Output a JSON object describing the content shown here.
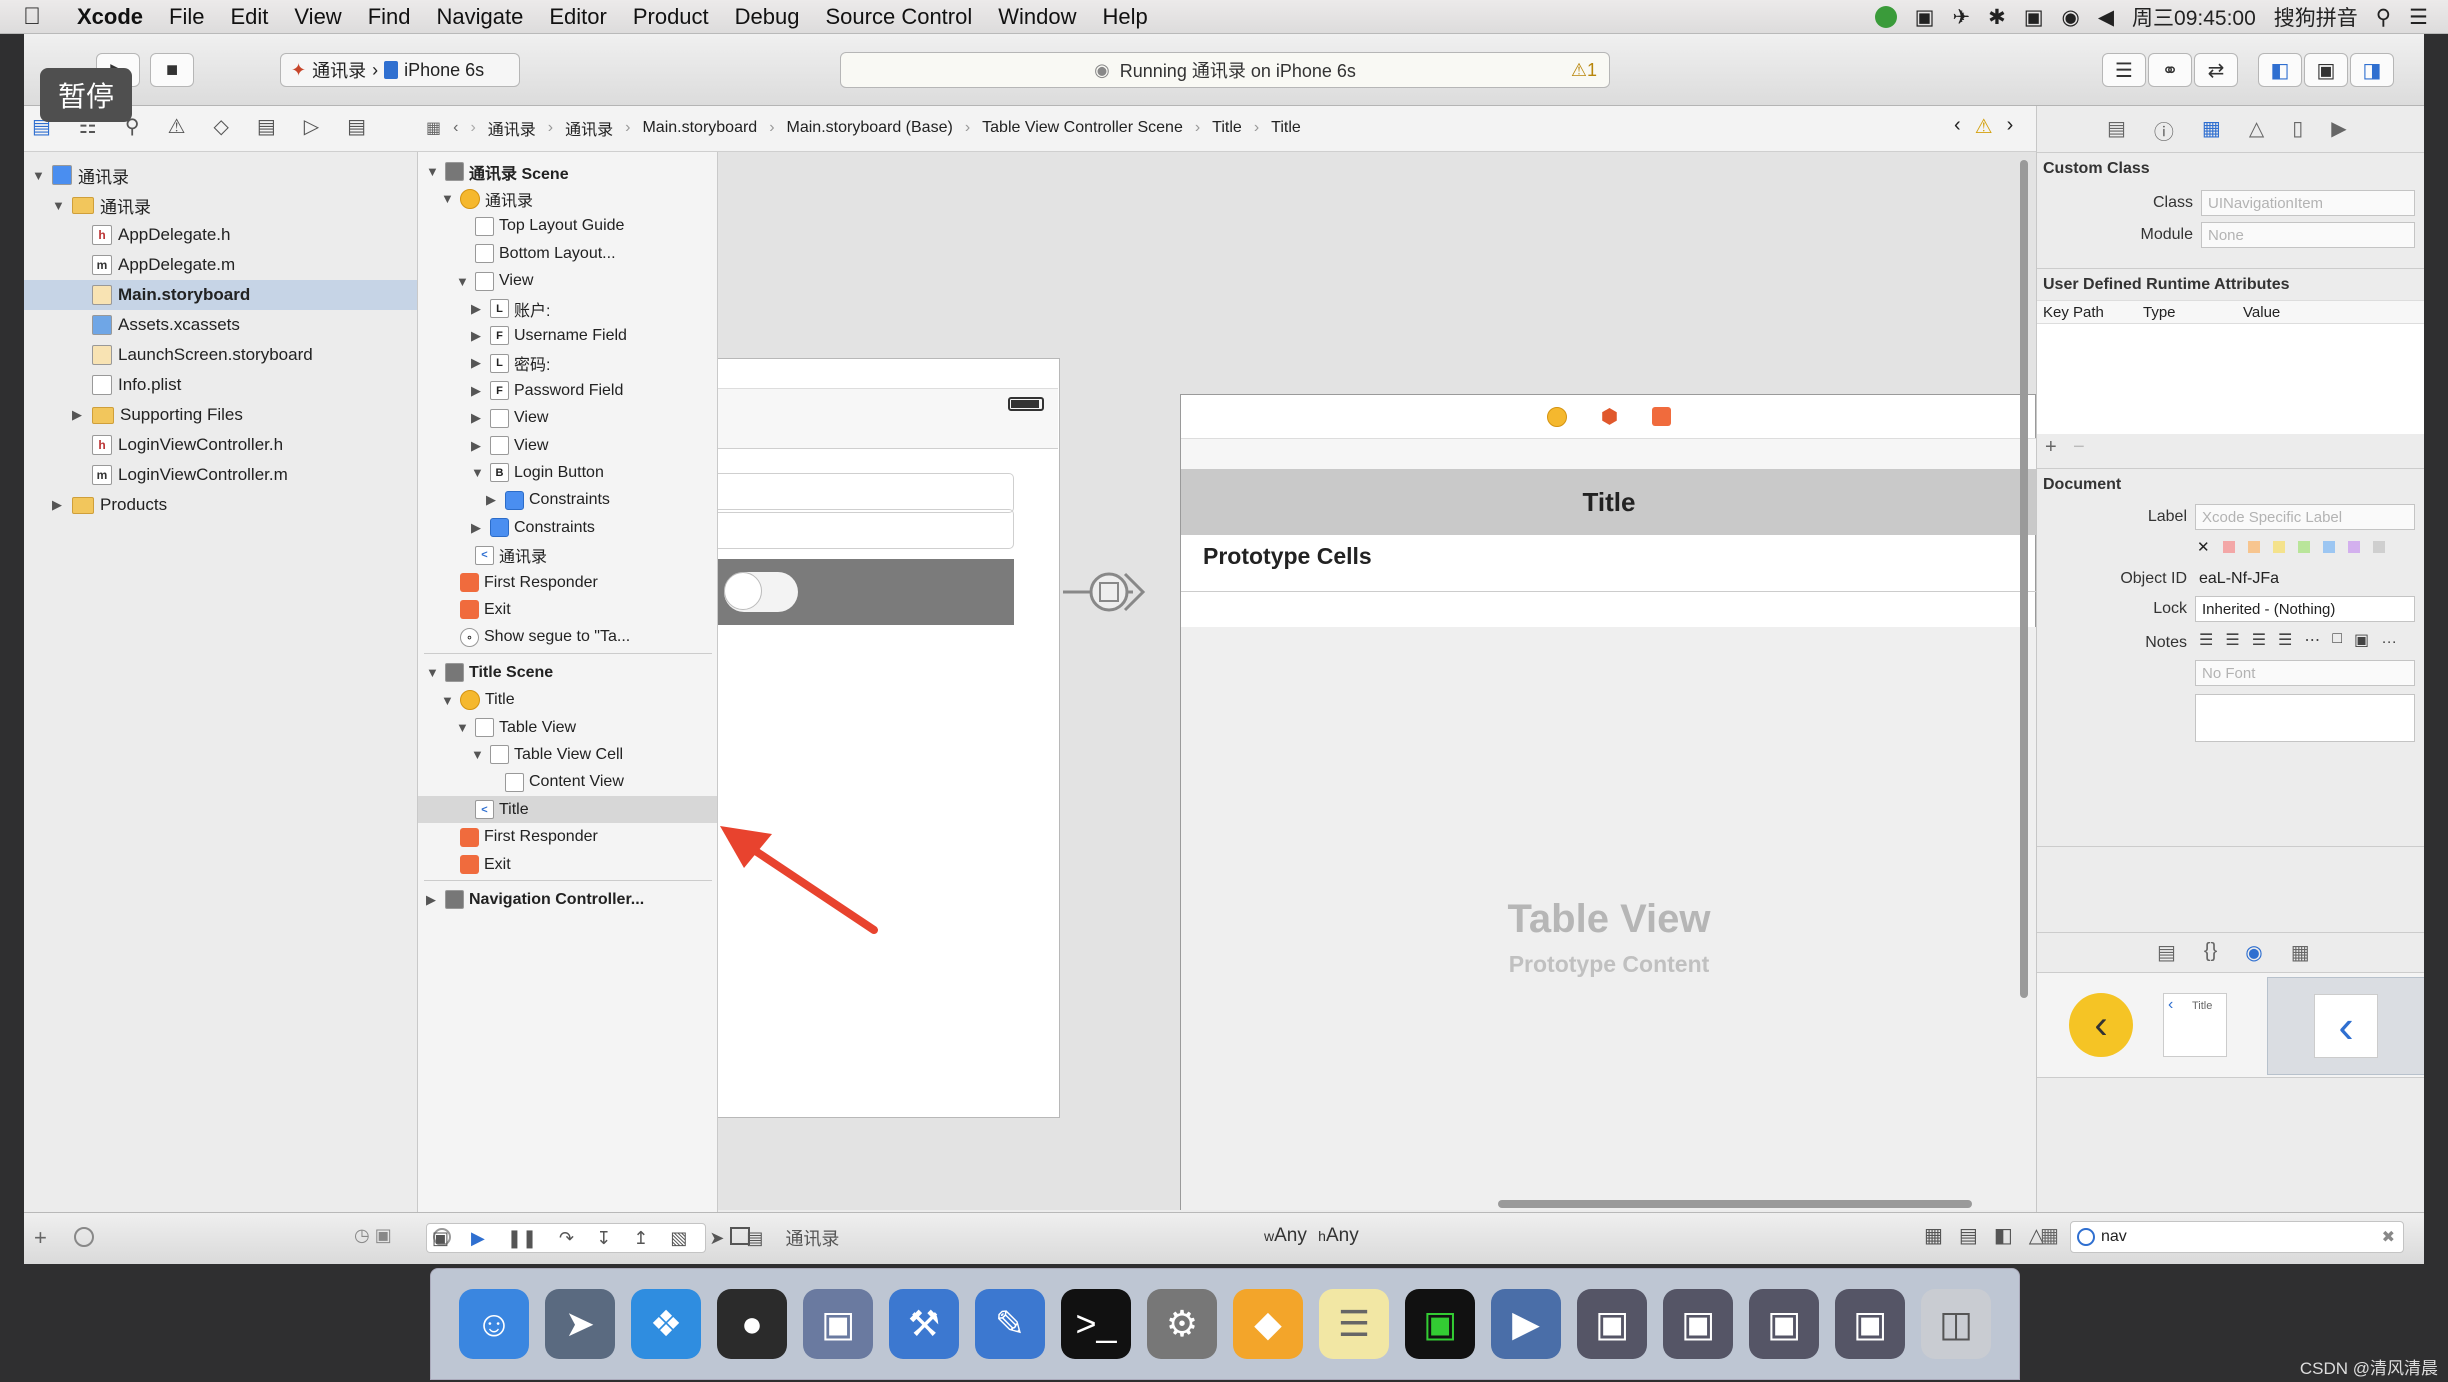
{
  "menubar": {
    "app": "Xcode",
    "items": [
      "File",
      "Edit",
      "View",
      "Find",
      "Navigate",
      "Editor",
      "Product",
      "Debug",
      "Source Control",
      "Window",
      "Help"
    ],
    "clock": "周三09:45:00",
    "input_method": "搜狗拼音"
  },
  "toolbar": {
    "pause_badge": "暂停",
    "scheme_project": "通讯录",
    "scheme_device": "iPhone 6s",
    "activity": "Running 通讯录 on iPhone 6s",
    "warning_count": "1"
  },
  "jumpbar": [
    "通讯录",
    "通讯录",
    "Main.storyboard",
    "Main.storyboard (Base)",
    "Table View Controller Scene",
    "Title",
    "Title"
  ],
  "project_navigator": [
    {
      "label": "通讯录",
      "type": "project",
      "level": 0,
      "expanded": true
    },
    {
      "label": "通讯录",
      "type": "folder",
      "level": 1,
      "expanded": true
    },
    {
      "label": "AppDelegate.h",
      "type": "h",
      "level": 2
    },
    {
      "label": "AppDelegate.m",
      "type": "m",
      "level": 2
    },
    {
      "label": "Main.storyboard",
      "type": "storyboard",
      "level": 2,
      "selected": true
    },
    {
      "label": "Assets.xcassets",
      "type": "assets",
      "level": 2
    },
    {
      "label": "LaunchScreen.storyboard",
      "type": "storyboard",
      "level": 2
    },
    {
      "label": "Info.plist",
      "type": "plist",
      "level": 2
    },
    {
      "label": "Supporting Files",
      "type": "folder",
      "level": 2,
      "collapsed": true
    },
    {
      "label": "LoginViewController.h",
      "type": "h",
      "level": 2
    },
    {
      "label": "LoginViewController.m",
      "type": "m",
      "level": 2
    },
    {
      "label": "Products",
      "type": "folder",
      "level": 1,
      "collapsed": true
    }
  ],
  "outline": [
    {
      "label": "通讯录 Scene",
      "bold": true,
      "level": 0,
      "icon": "scene",
      "tri": "down"
    },
    {
      "label": "通讯录",
      "level": 1,
      "icon": "yellow",
      "tri": "down"
    },
    {
      "label": "Top Layout Guide",
      "level": 2,
      "icon": "box"
    },
    {
      "label": "Bottom Layout...",
      "level": 2,
      "icon": "box"
    },
    {
      "label": "View",
      "level": 2,
      "icon": "box",
      "tri": "down"
    },
    {
      "label": "账户:",
      "level": 3,
      "icon": "L",
      "tri": "right"
    },
    {
      "label": "Username Field",
      "level": 3,
      "icon": "F",
      "tri": "right"
    },
    {
      "label": "密码:",
      "level": 3,
      "icon": "L",
      "tri": "right"
    },
    {
      "label": "Password Field",
      "level": 3,
      "icon": "F",
      "tri": "right"
    },
    {
      "label": "View",
      "level": 3,
      "icon": "box",
      "tri": "right"
    },
    {
      "label": "View",
      "level": 3,
      "icon": "box",
      "tri": "right"
    },
    {
      "label": "Login Button",
      "level": 3,
      "icon": "B",
      "tri": "down"
    },
    {
      "label": "Constraints",
      "level": 4,
      "icon": "blue",
      "tri": "right"
    },
    {
      "label": "Constraints",
      "level": 3,
      "icon": "blue",
      "tri": "right"
    },
    {
      "label": "通讯录",
      "level": 2,
      "icon": "back"
    },
    {
      "label": "First Responder",
      "level": 1,
      "icon": "red"
    },
    {
      "label": "Exit",
      "level": 1,
      "icon": "red"
    },
    {
      "label": "Show segue to \"Ta...",
      "level": 1,
      "icon": "segue"
    },
    {
      "label": "Title Scene",
      "bold": true,
      "level": 0,
      "icon": "scene",
      "tri": "down",
      "gap": true
    },
    {
      "label": "Title",
      "level": 1,
      "icon": "yellow",
      "tri": "down"
    },
    {
      "label": "Table View",
      "level": 2,
      "icon": "box",
      "tri": "down"
    },
    {
      "label": "Table View Cell",
      "level": 3,
      "icon": "box",
      "tri": "down"
    },
    {
      "label": "Content View",
      "level": 4,
      "icon": "box"
    },
    {
      "label": "Title",
      "level": 2,
      "icon": "back",
      "selected": true
    },
    {
      "label": "First Responder",
      "level": 1,
      "icon": "red"
    },
    {
      "label": "Exit",
      "level": 1,
      "icon": "red"
    },
    {
      "label": "Navigation Controller...",
      "bold": true,
      "level": 0,
      "icon": "scene",
      "tri": "right",
      "gap": true
    }
  ],
  "canvas": {
    "nav_title": "Title",
    "prototype_cells": "Prototype Cells",
    "table_view": "Table View",
    "prototype_content": "Prototype Content",
    "size_class_w": "w",
    "size_class_w_value": "Any",
    "size_class_h": "h",
    "size_class_h_value": "Any"
  },
  "inspector": {
    "custom_class_header": "Custom Class",
    "class_label": "Class",
    "class_placeholder": "UINavigationItem",
    "module_label": "Module",
    "module_placeholder": "None",
    "udra_header": "User Defined Runtime Attributes",
    "col_key_path": "Key Path",
    "col_type": "Type",
    "col_value": "Value",
    "document_header": "Document",
    "label_label": "Label",
    "label_placeholder": "Xcode Specific Label",
    "object_id_label": "Object ID",
    "object_id": "eaL-Nf-JFa",
    "lock_label": "Lock",
    "lock_value": "Inherited - (Nothing)",
    "notes_label": "Notes",
    "font_placeholder": "No Font",
    "library_filter": "nav",
    "library_item_title": "Title"
  },
  "bottom": {
    "debug_target": "通讯录"
  },
  "colors": {
    "accent_blue": "#3478f6",
    "selection": "#c6d4e6",
    "arrow_red": "#e8432e",
    "yellow_back": "#f5c425"
  },
  "footer_watermark": "CSDN @清风清晨"
}
